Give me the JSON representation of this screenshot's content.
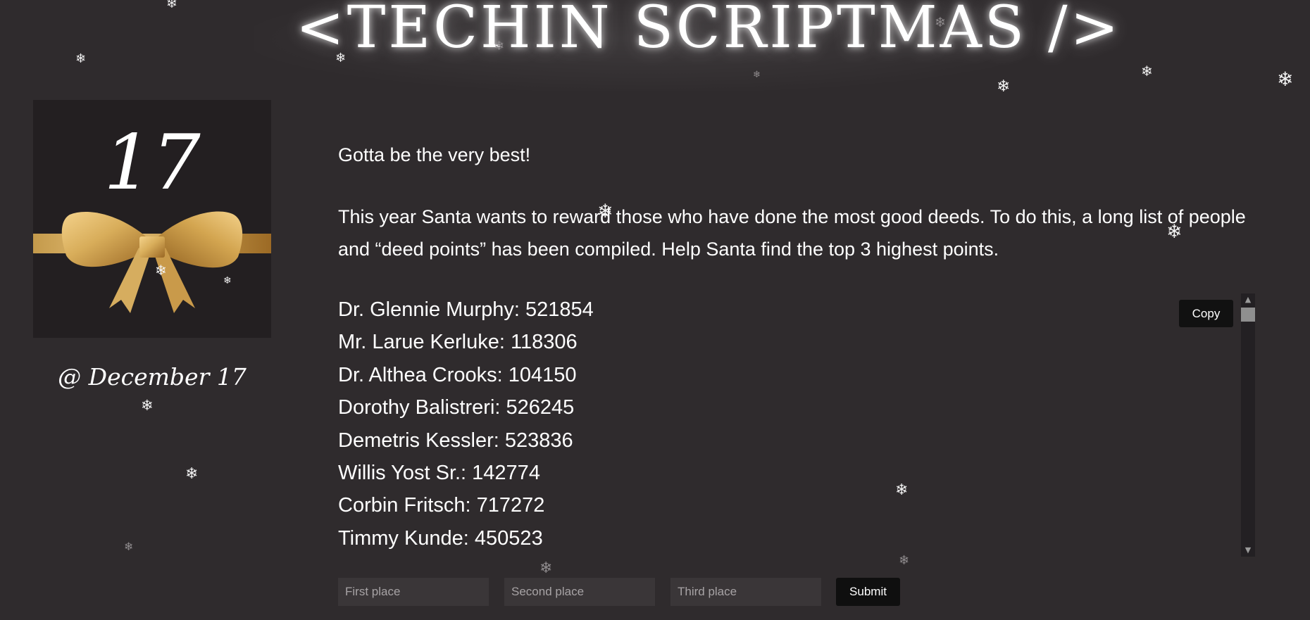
{
  "header": {
    "title": "<TECHIN SCRIPTMAS />"
  },
  "day_card": {
    "number": "17",
    "date_caption": "@ December 17"
  },
  "content": {
    "heading": "Gotta be the very best!",
    "intro": "This year Santa wants to reward those who have done the most good deeds. To do this, a long list of people and “deed points” has been compiled. Help Santa find the top 3 highest points.",
    "items": [
      "Dr. Glennie Murphy: 521854",
      "Mr. Larue Kerluke: 118306",
      "Dr. Althea Crooks: 104150",
      "Dorothy Balistreri: 526245",
      "Demetris Kessler: 523836",
      "Willis Yost Sr.: 142774",
      "Corbin Fritsch: 717272",
      "Timmy Kunde: 450523"
    ]
  },
  "controls": {
    "copy_label": "Copy",
    "first_placeholder": "First place",
    "second_placeholder": "Second place",
    "third_placeholder": "Third place",
    "submit_label": "Submit"
  },
  "icons": {
    "snowflake": "snowflake-icon",
    "scroll_up": "chevron-up-icon",
    "scroll_down": "chevron-down-icon"
  },
  "colors": {
    "background": "#2f2b2d",
    "card": "#231f21",
    "ribbon": "#d6ad5f",
    "button": "#111111"
  }
}
